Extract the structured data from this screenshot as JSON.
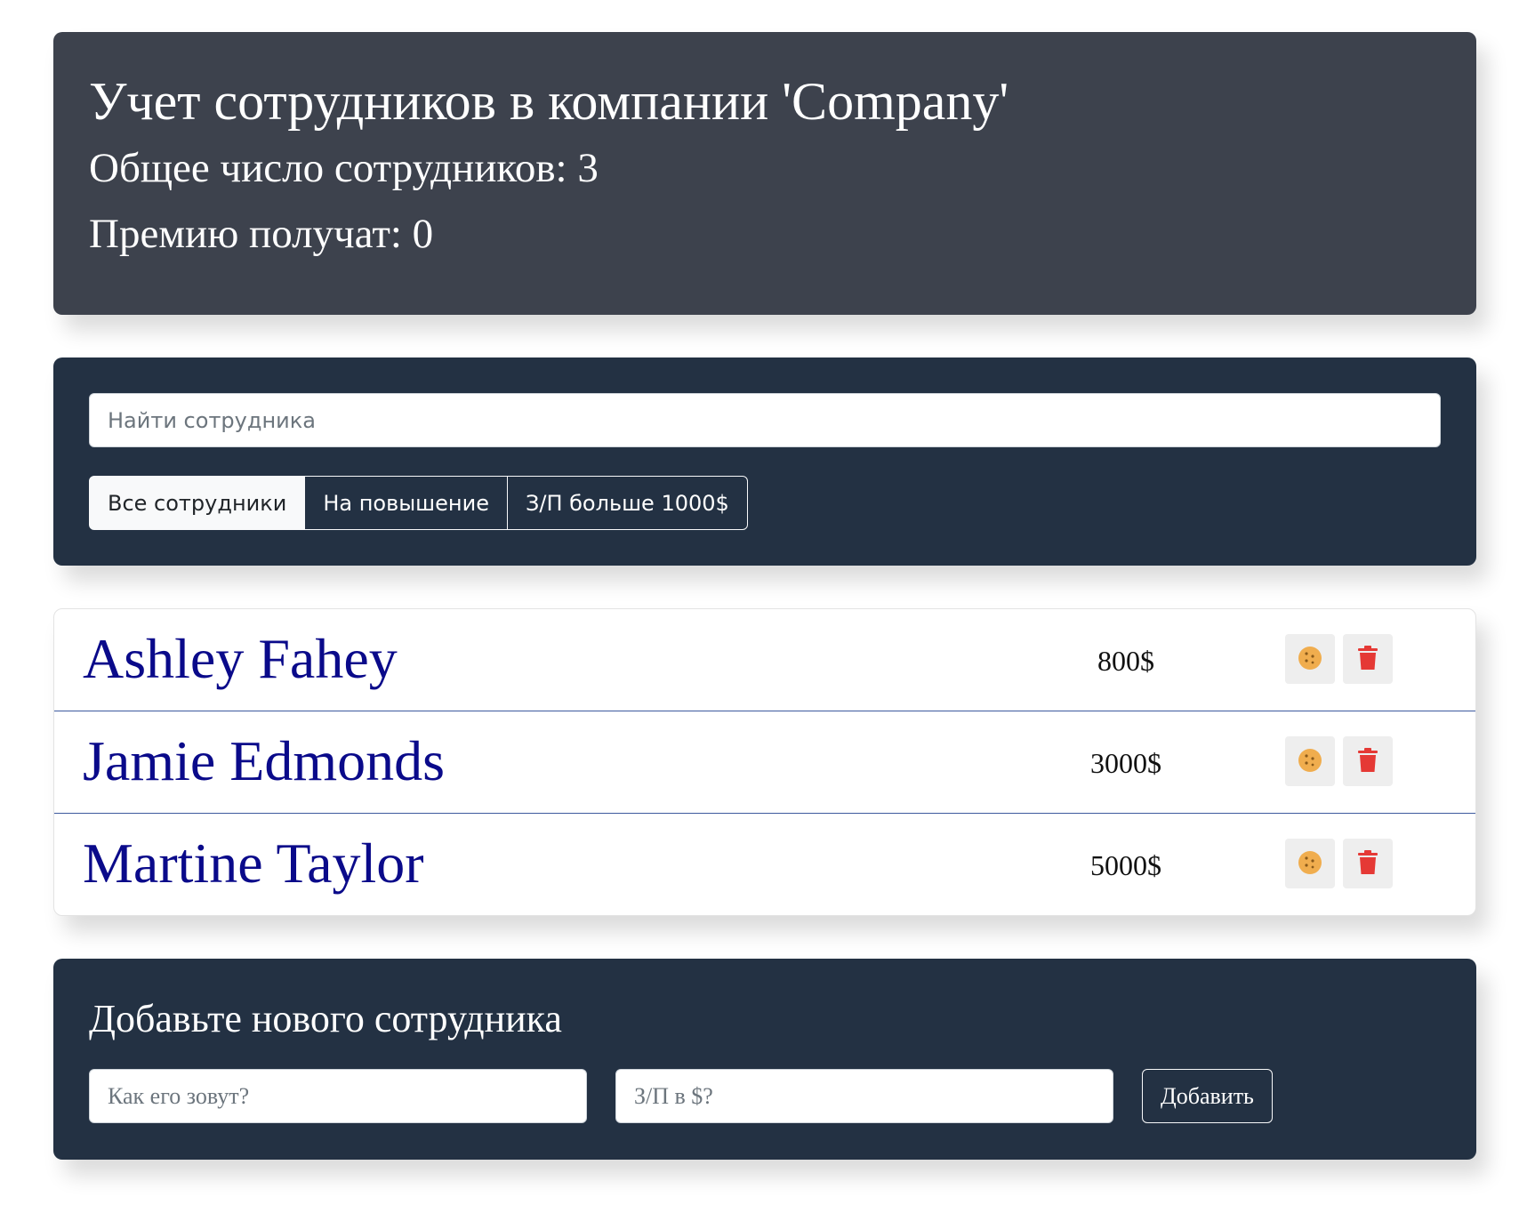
{
  "info": {
    "title": "Учет сотрудников в компании 'Company'",
    "total_label": "Общее число сотрудников: 3",
    "bonus_label": "Премию получат: 0"
  },
  "search": {
    "placeholder": "Найти сотрудника"
  },
  "filters": [
    {
      "label": "Все сотрудники",
      "active": true
    },
    {
      "label": "На повышение",
      "active": false
    },
    {
      "label": "З/П больше 1000$",
      "active": false
    }
  ],
  "employees": [
    {
      "name": "Ashley Fahey",
      "salary": "800$"
    },
    {
      "name": "Jamie Edmonds",
      "salary": "3000$"
    },
    {
      "name": "Martine Taylor",
      "salary": "5000$"
    }
  ],
  "add_form": {
    "title": "Добавьте нового сотрудника",
    "name_placeholder": "Как его зовут?",
    "salary_placeholder": "З/П в $?",
    "submit_label": "Добавить"
  },
  "icons": {
    "cookie": "cookie-icon",
    "trash": "trash-icon"
  },
  "colors": {
    "info_bg": "#3d424d",
    "panel_bg": "#233143",
    "name_color": "#0a0a8a",
    "cookie_color": "#f0ad4e",
    "trash_color": "#e53935"
  }
}
